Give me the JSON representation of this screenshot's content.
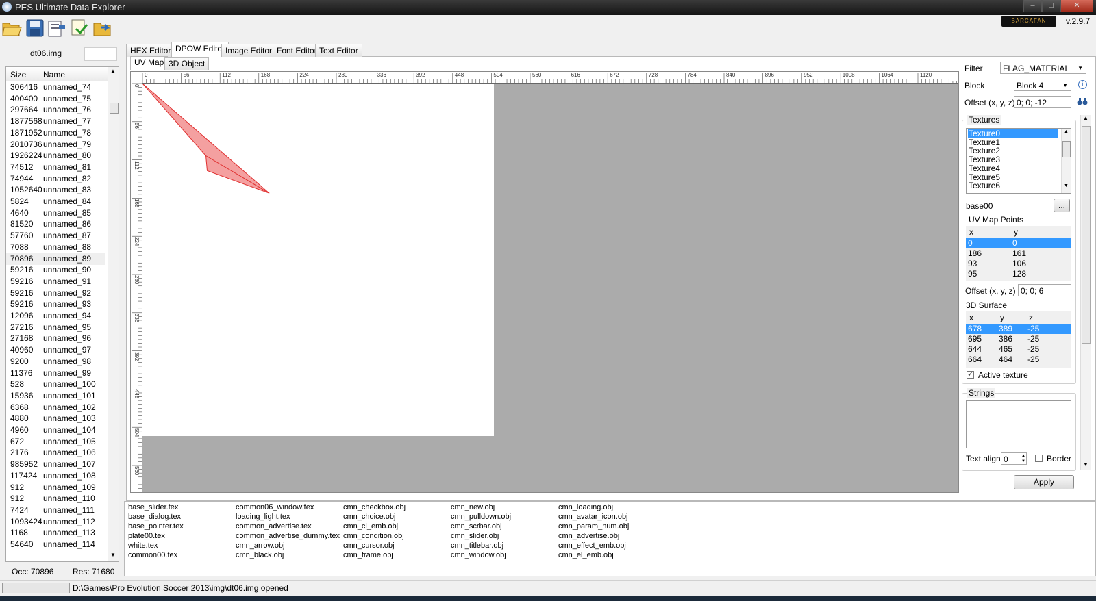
{
  "window": {
    "title": "PES Ultimate Data Explorer",
    "minimize": "–",
    "maximize": "□",
    "close": "✕"
  },
  "toolbar": {
    "logo_text": "BARCAFAN",
    "version": "v.2.9.7"
  },
  "left": {
    "file_name": "dt06.img",
    "columns": [
      "Size",
      "Name"
    ],
    "rows": [
      [
        "306416",
        "unnamed_74"
      ],
      [
        "400400",
        "unnamed_75"
      ],
      [
        "297664",
        "unnamed_76"
      ],
      [
        "1877568",
        "unnamed_77"
      ],
      [
        "1871952",
        "unnamed_78"
      ],
      [
        "2010736",
        "unnamed_79"
      ],
      [
        "1926224",
        "unnamed_80"
      ],
      [
        "74512",
        "unnamed_81"
      ],
      [
        "74944",
        "unnamed_82"
      ],
      [
        "1052640",
        "unnamed_83"
      ],
      [
        "5824",
        "unnamed_84"
      ],
      [
        "4640",
        "unnamed_85"
      ],
      [
        "81520",
        "unnamed_86"
      ],
      [
        "57760",
        "unnamed_87"
      ],
      [
        "7088",
        "unnamed_88"
      ],
      [
        "70896",
        "unnamed_89"
      ],
      [
        "59216",
        "unnamed_90"
      ],
      [
        "59216",
        "unnamed_91"
      ],
      [
        "59216",
        "unnamed_92"
      ],
      [
        "59216",
        "unnamed_93"
      ],
      [
        "12096",
        "unnamed_94"
      ],
      [
        "27216",
        "unnamed_95"
      ],
      [
        "27168",
        "unnamed_96"
      ],
      [
        "40960",
        "unnamed_97"
      ],
      [
        "9200",
        "unnamed_98"
      ],
      [
        "11376",
        "unnamed_99"
      ],
      [
        "528",
        "unnamed_100"
      ],
      [
        "15936",
        "unnamed_101"
      ],
      [
        "6368",
        "unnamed_102"
      ],
      [
        "4880",
        "unnamed_103"
      ],
      [
        "4960",
        "unnamed_104"
      ],
      [
        "672",
        "unnamed_105"
      ],
      [
        "2176",
        "unnamed_106"
      ],
      [
        "985952",
        "unnamed_107"
      ],
      [
        "117424",
        "unnamed_108"
      ],
      [
        "912",
        "unnamed_109"
      ],
      [
        "912",
        "unnamed_110"
      ],
      [
        "7424",
        "unnamed_111"
      ],
      [
        "1093424",
        "unnamed_112"
      ],
      [
        "1168",
        "unnamed_113"
      ],
      [
        "54640",
        "unnamed_114"
      ]
    ],
    "selected_row": 15,
    "occ": "Occ: 70896",
    "res": "Res: 71680"
  },
  "tabs": [
    "HEX Editor",
    "DPOW Editor",
    "Image  Editor",
    "Font Editor",
    "Text Editor"
  ],
  "active_tab": 1,
  "subtabs": [
    "UV Map",
    "3D Object"
  ],
  "ruler": {
    "top": [
      "0",
      "56",
      "112",
      "168",
      "224",
      "280",
      "336",
      "392",
      "448",
      "504",
      "560",
      "616",
      "672",
      "728",
      "784",
      "840",
      "896",
      "952",
      "1008",
      "1064",
      "1120"
    ],
    "left": [
      "0",
      "56",
      "112",
      "168",
      "224",
      "280",
      "336",
      "392",
      "448",
      "504",
      "560"
    ]
  },
  "right": {
    "filter_label": "Filter",
    "filter_value": "FLAG_MATERIAL",
    "block_label": "Block",
    "block_value": "Block 4",
    "offset_label": "Offset (x, y, z)",
    "offset_value": "0; 0; -12",
    "textures_label": "Textures",
    "textures": [
      "Texture0",
      "Texture1",
      "Texture2",
      "Texture3",
      "Texture4",
      "Texture5",
      "Texture6"
    ],
    "texture_name": "base00",
    "browse_label": "...",
    "uv_label": "UV Map Points",
    "uv_cols": [
      "x",
      "y"
    ],
    "uv_points": [
      [
        "0",
        "0"
      ],
      [
        "186",
        "161"
      ],
      [
        "93",
        "106"
      ],
      [
        "95",
        "128"
      ]
    ],
    "offset2_label": "Offset (x, y, z)",
    "offset2_value": "0; 0; 6",
    "surface_label": "3D Surface",
    "surface_cols": [
      "x",
      "y",
      "z"
    ],
    "surface_points": [
      [
        "678",
        "389",
        "-25"
      ],
      [
        "695",
        "386",
        "-25"
      ],
      [
        "644",
        "465",
        "-25"
      ],
      [
        "664",
        "464",
        "-25"
      ]
    ],
    "active_texture_label": "Active texture",
    "strings_label": "Strings",
    "text_align_label": "Text align",
    "text_align_value": "0",
    "border_label": "Border",
    "apply_label": "Apply"
  },
  "files": [
    [
      "base_slider.tex",
      "base_dialog.tex",
      "base_pointer.tex",
      "plate00.tex",
      "white.tex",
      "common00.tex"
    ],
    [
      "common06_window.tex",
      "loading_light.tex",
      "common_advertise.tex",
      "common_advertise_dummy.tex",
      "cmn_arrow.obj",
      "cmn_black.obj"
    ],
    [
      "cmn_checkbox.obj",
      "cmn_choice.obj",
      "cmn_cl_emb.obj",
      "cmn_condition.obj",
      "cmn_cursor.obj",
      "cmn_frame.obj"
    ],
    [
      "cmn_new.obj",
      "cmn_pulldown.obj",
      "cmn_scrbar.obj",
      "cmn_slider.obj",
      "cmn_titlebar.obj",
      "cmn_window.obj"
    ],
    [
      "cmn_loading.obj",
      "cmn_avatar_icon.obj",
      "cmn_param_num.obj",
      "cmn_advertise.obj",
      "cmn_effect_emb.obj",
      "cmn_el_emb.obj"
    ]
  ],
  "status": {
    "text": "D:\\Games\\Pro Evolution Soccer 2013\\img\\dt06.img opened"
  },
  "colors": {
    "selection": "#3399ff",
    "uv_fill": "#f4a0a0",
    "uv_stroke": "#e03030",
    "canvas_bg": "#ababab"
  }
}
